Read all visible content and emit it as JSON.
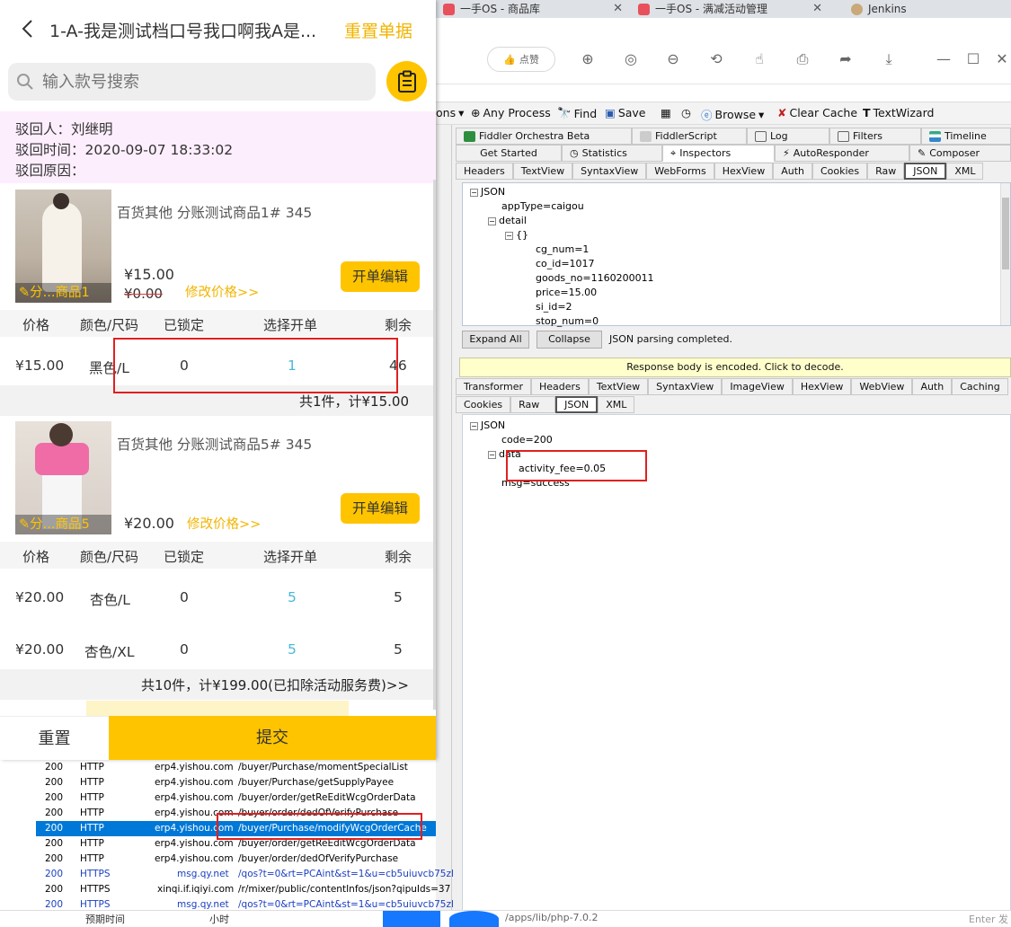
{
  "browser": {
    "tabs": [
      {
        "label": "一手OS - 商品库",
        "fav_color": "#e8505b"
      },
      {
        "label": "一手OS - 满减活动管理",
        "fav_color": "#e8505b"
      },
      {
        "label": "Jenkins",
        "fav_color": "#c9a87a"
      }
    ],
    "like_label": "点赞"
  },
  "fiddler": {
    "toolbar": {
      "partial": "ons",
      "any_process": "Any Process",
      "find": "Find",
      "save": "Save",
      "browse": "Browse",
      "clear_cache": "Clear Cache",
      "text_wizard": "TextWizard"
    },
    "top_tabs_row1": [
      "Fiddler Orchestra Beta",
      "FiddlerScript",
      "Log",
      "Filters",
      "Timeline"
    ],
    "top_tabs_row2": [
      "Get Started",
      "Statistics",
      "Inspectors",
      "AutoResponder",
      "Composer"
    ],
    "request_tabs": [
      "Headers",
      "TextView",
      "SyntaxView",
      "WebForms",
      "HexView",
      "Auth",
      "Cookies",
      "Raw",
      "JSON",
      "XML"
    ],
    "request_tree": {
      "root": "JSON",
      "app_type": "appType=caigou",
      "detail": "detail",
      "obj": "{}",
      "cg_num": "cg_num=1",
      "co_id": "co_id=1017",
      "goods_no": "goods_no=1160200011",
      "price": "price=15.00",
      "si_id": "si_id=2",
      "stop_num": "stop_num=0"
    },
    "expand_all": "Expand All",
    "collapse": "Collapse",
    "parse_status": "JSON parsing completed.",
    "response_banner": "Response body is encoded. Click to decode.",
    "response_tabs_row1": [
      "Transformer",
      "Headers",
      "TextView",
      "SyntaxView",
      "ImageView",
      "HexView",
      "WebView",
      "Auth",
      "Caching"
    ],
    "response_tabs_row2": [
      "Cookies",
      "Raw",
      "JSON",
      "XML"
    ],
    "response_tree": {
      "root": "JSON",
      "code": "code=200",
      "data": "data",
      "activity_fee": "activity_fee=0.05",
      "msg": "msg=success"
    },
    "sessions": [
      {
        "status": "200",
        "proto": "HTTP",
        "host": "erp4.yishou.com",
        "url": "/buyer/Purchase/momentSpecialList"
      },
      {
        "status": "200",
        "proto": "HTTP",
        "host": "erp4.yishou.com",
        "url": "/buyer/Purchase/getSupplyPayee"
      },
      {
        "status": "200",
        "proto": "HTTP",
        "host": "erp4.yishou.com",
        "url": "/buyer/order/getReEditWcgOrderData"
      },
      {
        "status": "200",
        "proto": "HTTP",
        "host": "erp4.yishou.com",
        "url": "/buyer/order/dedOfVerifyPurchase"
      },
      {
        "status": "200",
        "proto": "HTTP",
        "host": "erp4.yishou.com",
        "url": "/buyer/Purchase/modifyWcgOrderCache"
      },
      {
        "status": "200",
        "proto": "HTTP",
        "host": "erp4.yishou.com",
        "url": "/buyer/order/getReEditWcgOrderData"
      },
      {
        "status": "200",
        "proto": "HTTP",
        "host": "erp4.yishou.com",
        "url": "/buyer/order/dedOfVerifyPurchase"
      },
      {
        "status": "200",
        "proto": "HTTPS",
        "host": "msg.qy.net",
        "url": "/qos?t=0&rt=PCAint&st=1&u=cb5uiuvcb75zl"
      },
      {
        "status": "200",
        "proto": "HTTPS",
        "host": "xinqi.if.iqiyi.com",
        "url": "/r/mixer/public/contentInfos/json?qipuIds=37"
      },
      {
        "status": "200",
        "proto": "HTTPS",
        "host": "msg.qy.net",
        "url": "/qos?t=0&rt=PCAint&st=1&u=cb5uiuvcb75zl"
      }
    ],
    "status_strip": {
      "left": "预期时间",
      "mid": "小时",
      "path": "/apps/lib/php-7.0.2",
      "right": "Enter 发"
    }
  },
  "app": {
    "title": "1-A-我是测试档口号我口啊我A是...",
    "reset_doc": "重置单据",
    "search_placeholder": "输入款号搜索",
    "reject": {
      "person": "驳回人：刘继明",
      "time": "驳回时间：2020-09-07 18:33:02",
      "reason": "驳回原因："
    },
    "products": [
      {
        "name": "百货其他  分账测试商品1#  345",
        "caption": "分...商品1",
        "price": "¥15.00",
        "old_price": "¥0.00",
        "edit_price": "修改价格>>",
        "open_edit": "开单编辑",
        "header": [
          "价格",
          "颜色/尺码",
          "已锁定",
          "选择开单",
          "剩余"
        ],
        "rows": [
          [
            "¥15.00",
            "黑色/L",
            "0",
            "1",
            "46"
          ]
        ],
        "summary": "共1件，计¥15.00"
      },
      {
        "name": "百货其他  分账测试商品5#  345",
        "caption": "分...商品5",
        "price": "¥20.00",
        "edit_price": "修改价格>>",
        "open_edit": "开单编辑",
        "header": [
          "价格",
          "颜色/尺码",
          "已锁定",
          "选择开单",
          "剩余"
        ],
        "rows": [
          [
            "¥20.00",
            "杏色/L",
            "0",
            "5",
            "5"
          ],
          [
            "¥20.00",
            "杏色/XL",
            "0",
            "5",
            "5"
          ]
        ],
        "summary": "共10件，计¥199.00(已扣除活动服务费)>>"
      }
    ],
    "footer": {
      "reset": "重置",
      "submit": "提交"
    }
  },
  "colors": {
    "accent_yellow": "#ffc400",
    "link_blue": "#4ab8d8",
    "selected_session": "#0078d7",
    "highlight_red": "#e02020"
  }
}
